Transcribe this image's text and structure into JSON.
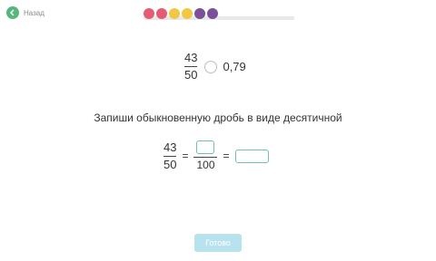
{
  "header": {
    "back_label": "Назад",
    "progress_dots": [
      "#e35c72",
      "#e35c72",
      "#f2c744",
      "#f2c744",
      "#7b4f9a",
      "#7b4f9a"
    ],
    "accent_color": "#55b77c"
  },
  "comparison": {
    "numerator": "43",
    "denominator": "50",
    "decimal": "0,79"
  },
  "instruction": "Запиши обыкновенную дробь в виде десятичной",
  "equation": {
    "numerator": "43",
    "denominator": "50",
    "equals1": "=",
    "hundred": "100",
    "equals2": "="
  },
  "footer": {
    "ready_label": "Готово"
  }
}
